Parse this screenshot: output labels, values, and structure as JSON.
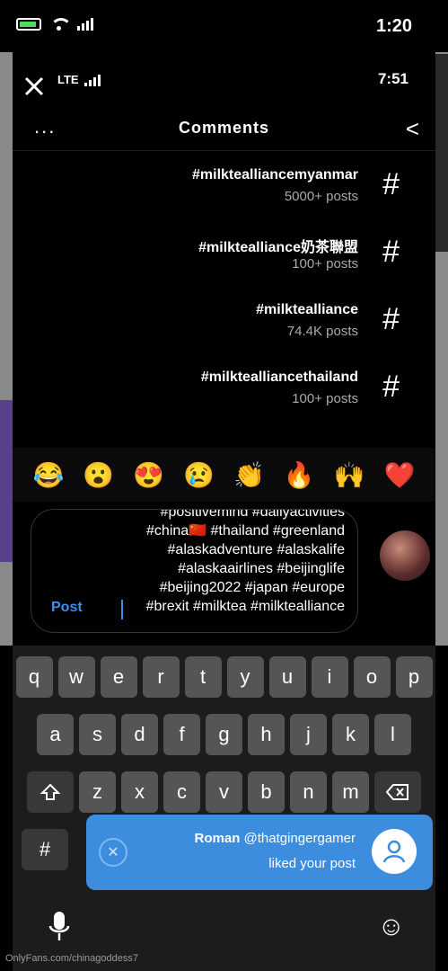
{
  "status": {
    "time": "1:20"
  },
  "inner_status": {
    "time": "7:51",
    "network": "LTE"
  },
  "header": {
    "title": "Comments",
    "more": "...",
    "back": "<"
  },
  "hashtags": [
    {
      "tag": "#milktealliancemyanmar",
      "count": "5000+ posts"
    },
    {
      "tag": "#milktealliance奶茶聯盟",
      "count": "100+ posts"
    },
    {
      "tag": "#milktealliance",
      "count": "74.4K posts"
    },
    {
      "tag": "#milktealliancethailand",
      "count": "100+ posts"
    }
  ],
  "emojis": [
    "😂",
    "😮",
    "😍",
    "😢",
    "👏",
    "🔥",
    "🙌",
    "❤️"
  ],
  "compose": {
    "lines": [
      "#positivemind #dailyactivities",
      "#china🇨🇳 #thailand #greenland",
      "#alaskadventure #alaskalife",
      "#alaskaairlines #beijinglife",
      "#beijing2022 #japan #europe",
      "#brexit #milktea #milktealliance"
    ],
    "post_label": "Post"
  },
  "keyboard": {
    "row1": [
      "q",
      "w",
      "e",
      "r",
      "t",
      "y",
      "u",
      "i",
      "o",
      "p"
    ],
    "row2": [
      "a",
      "s",
      "d",
      "f",
      "g",
      "h",
      "j",
      "k",
      "l"
    ],
    "row3": [
      "z",
      "x",
      "c",
      "v",
      "b",
      "n",
      "m"
    ],
    "row4_left": "#"
  },
  "notification": {
    "user": "Roman",
    "handle": "@thatgingergamer",
    "message": "liked your post"
  },
  "watermark": "OnlyFans.com/chinagoddess7"
}
